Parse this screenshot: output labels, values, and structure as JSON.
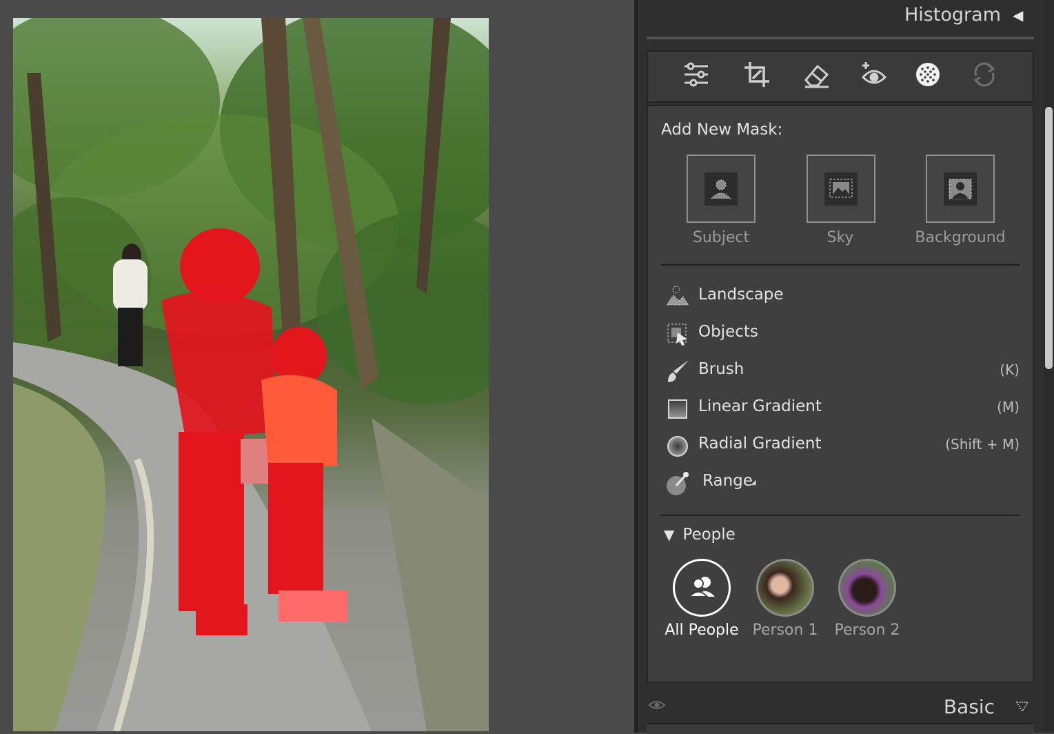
{
  "header": {
    "title": "Histogram"
  },
  "toolbar": {
    "tools": [
      "edit-sliders-icon",
      "crop-icon",
      "eraser-icon",
      "redeye-icon",
      "masking-icon",
      "presets-icon"
    ]
  },
  "masks": {
    "add_label": "Add New Mask:",
    "quick": [
      {
        "label": "Subject",
        "icon": "subject-icon"
      },
      {
        "label": "Sky",
        "icon": "sky-icon"
      },
      {
        "label": "Background",
        "icon": "background-icon"
      }
    ],
    "tools": [
      {
        "label": "Landscape",
        "key": "",
        "icon": "landscape-icon"
      },
      {
        "label": "Objects",
        "key": "",
        "icon": "objects-icon"
      },
      {
        "label": "Brush",
        "key": "(K)",
        "icon": "brush-icon"
      },
      {
        "label": "Linear Gradient",
        "key": "(M)",
        "icon": "linear-gradient-icon"
      },
      {
        "label": "Radial Gradient",
        "key": "(Shift + M)",
        "icon": "radial-gradient-icon"
      },
      {
        "label": "Range",
        "key": "",
        "icon": "range-icon"
      }
    ],
    "people": {
      "title": "People",
      "items": [
        {
          "label": "All People"
        },
        {
          "label": "Person 1"
        },
        {
          "label": "Person 2"
        }
      ]
    }
  },
  "basic": {
    "title": "Basic"
  },
  "colors": {
    "mask_overlay": "#e3161e",
    "panel_bg": "#3f3f3f",
    "accent_white": "#ffffff"
  }
}
